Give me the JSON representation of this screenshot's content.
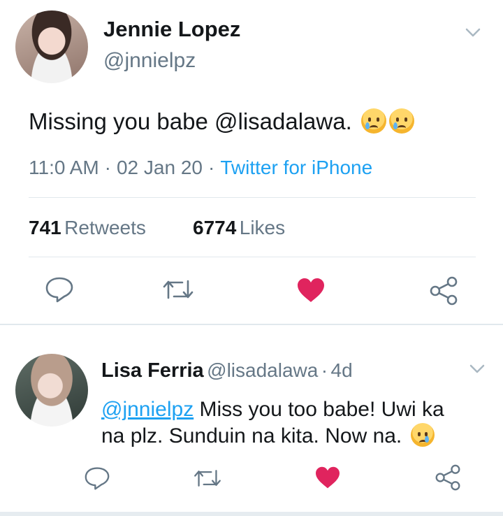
{
  "main_tweet": {
    "author_name": "Jennie Lopez",
    "author_handle": "@jnnielpz",
    "text": "Missing you babe @lisadalawa.",
    "emojis": [
      "crying-face-emoji",
      "crying-face-emoji"
    ],
    "time": "11:0 AM",
    "date": "02 Jan 20",
    "source": "Twitter for iPhone",
    "separator": "·",
    "retweets_count": "741",
    "retweets_label": "Retweets",
    "likes_count": "6774",
    "likes_label": "Likes"
  },
  "reply": {
    "author_name": "Lisa Ferria",
    "author_handle": "@lisadalawa",
    "separator": "·",
    "age": "4d",
    "mention": "@jnnielpz",
    "text_line1": " Miss you too babe! Uwi ka",
    "text_line2": "na plz. Sunduin na kita. Now na.",
    "emoji": "sleepy-face-emoji"
  },
  "colors": {
    "accent": "#1da1f2",
    "like": "#e0245e",
    "muted": "#657786",
    "text": "#14171a",
    "divider": "#e1e8ed"
  }
}
